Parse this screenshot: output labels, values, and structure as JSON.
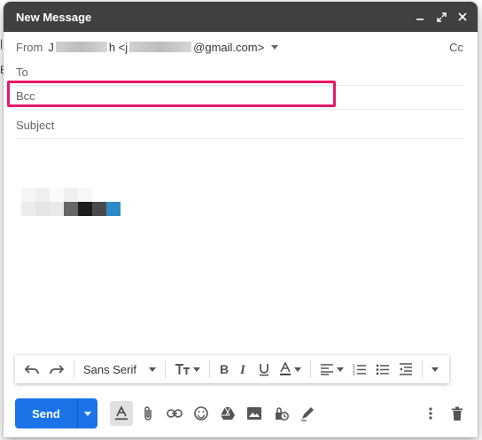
{
  "compose": {
    "title": "New Message",
    "from_label": "From",
    "from_value_prefix": "J",
    "from_value_mid": "h <j",
    "from_value_suffix": "@gmail.com>",
    "cc_label": "Cc",
    "to_placeholder": "To",
    "bcc_placeholder": "Bcc",
    "subject_placeholder": "Subject"
  },
  "format": {
    "font_name": "Sans Serif"
  },
  "bottom": {
    "send_label": "Send"
  },
  "colors": {
    "title_bar": "#404040",
    "send_button": "#1a73e8",
    "highlight": "#e8186a"
  },
  "icons": {
    "title_bar": [
      "minimize-icon",
      "expand-icon",
      "close-icon"
    ],
    "format_bar": [
      "undo-icon",
      "redo-icon",
      "text-size-icon",
      "bold-icon",
      "italic-icon",
      "underline-icon",
      "text-color-icon",
      "align-icon",
      "numbered-list-icon",
      "bulleted-list-icon",
      "indent-less-icon",
      "more-formatting-icon"
    ],
    "bottom_bar": [
      "formatting-options-icon",
      "attach-file-icon",
      "insert-link-icon",
      "insert-emoji-icon",
      "google-drive-icon",
      "insert-photo-icon",
      "confidential-mode-icon",
      "insert-signature-icon",
      "more-options-icon",
      "discard-draft-icon"
    ]
  }
}
